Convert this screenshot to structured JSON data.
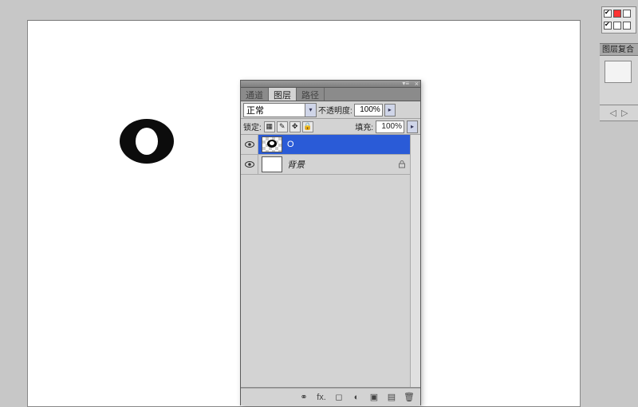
{
  "canvas": {
    "glyph": "O"
  },
  "panel": {
    "tabs": {
      "channels": "通道",
      "layers": "图层",
      "paths": "路径"
    },
    "blend_mode": "正常",
    "opacity_label": "不透明度:",
    "opacity_value": "100%",
    "lock_label": "锁定:",
    "fill_label": "填充:",
    "fill_value": "100%",
    "layers": [
      {
        "name": "O",
        "selected": true,
        "locked": false
      },
      {
        "name": "背景",
        "selected": false,
        "locked": true,
        "italic": true
      }
    ],
    "footer_icons": {
      "link": "⚭",
      "fx": "fx.",
      "mask": "◻",
      "adjust": "◐",
      "group": "▣",
      "new": "▤",
      "trash": "🗑"
    }
  },
  "side": {
    "comp_title": "图层复合"
  }
}
